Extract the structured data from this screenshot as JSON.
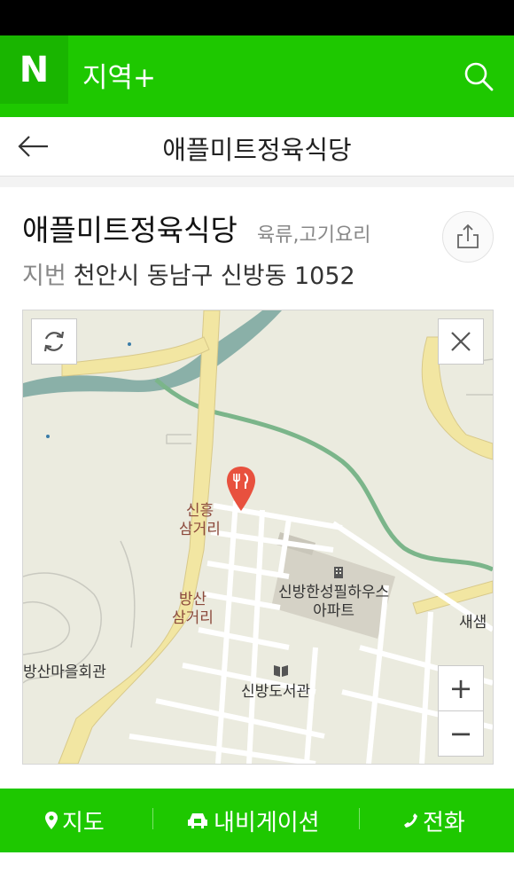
{
  "header": {
    "service": "지역+",
    "logo_letter": "N"
  },
  "subheader": {
    "title": "애플미트정육식당"
  },
  "place": {
    "name": "애플미트정육식당",
    "category": "육류,고기요리",
    "address_label": "지번",
    "address": "천안시 동남구 신방동 1052"
  },
  "map": {
    "labels": {
      "sinheung": "신흥\n삼거리",
      "bangsan": "방산\n삼거리",
      "bangsan_hall": "방산마을회관",
      "apartment": "신방한성필하우스\n아파트",
      "library": "신방도서관",
      "saesaem": "새샘"
    },
    "zoom_in": "+",
    "zoom_out": "−"
  },
  "bottom_bar": {
    "map": "지도",
    "navigation": "내비게이션",
    "call": "전화"
  },
  "colors": {
    "brand": "#1ec800",
    "pin": "#e8513e"
  }
}
